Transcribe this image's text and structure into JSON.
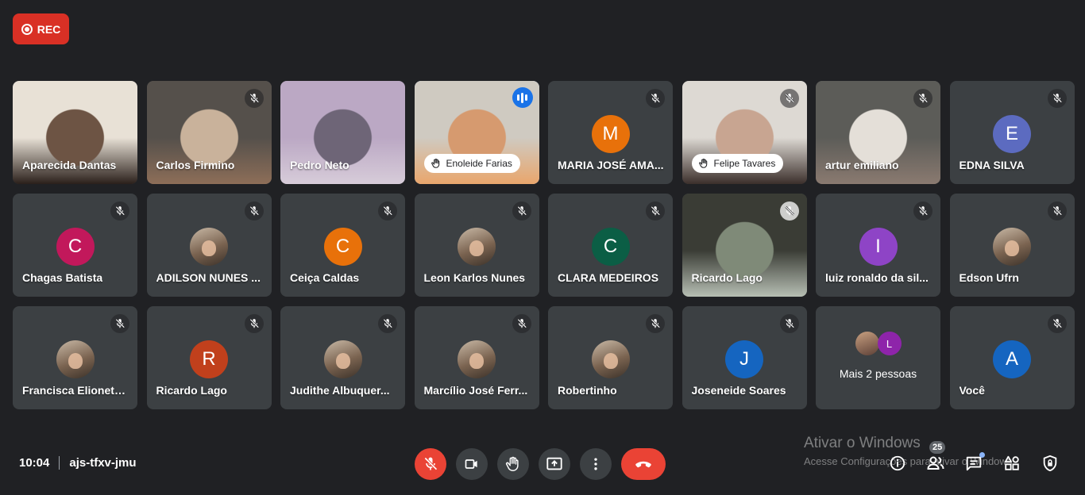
{
  "recording": {
    "label": "REC"
  },
  "tiles": [
    {
      "name": "Aparecida Dantas",
      "type": "video",
      "colors": [
        "#e8e1d6",
        "#6d5444",
        "#2a1f1a"
      ],
      "muted": false
    },
    {
      "name": "Carlos Firmino",
      "type": "video",
      "colors": [
        "#55504b",
        "#c9b29b",
        "#8d6e58"
      ],
      "muted": true
    },
    {
      "name": "Pedro Neto",
      "type": "video",
      "colors": [
        "#bba8c4",
        "#6e6577",
        "#d7ccd9"
      ],
      "muted": false
    },
    {
      "name": "Enoleide Farias",
      "type": "video-pill",
      "colors": [
        "#cfcac1",
        "#d69a6f",
        "#e9a66c"
      ],
      "speaking": true
    },
    {
      "name": "MARIA JOSÉ AMA...",
      "type": "initial",
      "initial": "M",
      "color": "#e8710a",
      "muted": true
    },
    {
      "name": "Felipe Tavares",
      "type": "video-pill",
      "colors": [
        "#ddd9d3",
        "#c8a591",
        "#3b2f2b"
      ],
      "muted": true
    },
    {
      "name": "artur emiliano",
      "type": "video",
      "colors": [
        "#5c5c58",
        "#e4dfd8",
        "#8a7a70"
      ],
      "muted": true
    },
    {
      "name": "EDNA SILVA",
      "type": "initial",
      "initial": "E",
      "color": "#5c6bc0",
      "muted": true
    },
    {
      "name": "Chagas Batista",
      "type": "initial",
      "initial": "C",
      "color": "#c2185b",
      "muted": true
    },
    {
      "name": "ADILSON NUNES ...",
      "type": "photo",
      "muted": true
    },
    {
      "name": "Ceiça Caldas",
      "type": "initial",
      "initial": "C",
      "color": "#e8710a",
      "muted": true
    },
    {
      "name": "Leon Karlos Nunes",
      "type": "photo",
      "muted": true
    },
    {
      "name": "CLARA MEDEIROS",
      "type": "initial",
      "initial": "C",
      "color": "#0b5e45",
      "muted": true
    },
    {
      "name": "Ricardo Lago",
      "type": "video",
      "colors": [
        "#3a3c35",
        "#7f8a78",
        "#b7bfb4"
      ],
      "muted": true,
      "light_mic": true
    },
    {
      "name": "luiz ronaldo da sil...",
      "type": "initial",
      "initial": "I",
      "color": "#8e44c6",
      "muted": true
    },
    {
      "name": "Edson Ufrn",
      "type": "photo",
      "muted": true
    },
    {
      "name": "Francisca Elionete...",
      "type": "photo",
      "muted": true
    },
    {
      "name": "Ricardo Lago",
      "type": "initial",
      "initial": "R",
      "color": "#c1401c",
      "muted": true
    },
    {
      "name": "Judithe Albuquer...",
      "type": "photo",
      "muted": true
    },
    {
      "name": "Marcílio José Ferr...",
      "type": "photo",
      "muted": true
    },
    {
      "name": "Robertinho",
      "type": "photo",
      "muted": true
    },
    {
      "name": "Joseneide Soares",
      "type": "initial",
      "initial": "J",
      "color": "#1565c0",
      "muted": true
    },
    {
      "name": "Mais 2 pessoas",
      "type": "more",
      "initial": "L"
    },
    {
      "name": "Você",
      "type": "initial",
      "initial": "A",
      "color": "#1565c0",
      "muted": true
    }
  ],
  "meeting": {
    "time": "10:04",
    "code": "ajs-tfxv-jmu"
  },
  "participants_count": "25",
  "watermark": {
    "title": "Ativar o Windows",
    "subtitle": "Acesse Configurações para ativar o Windows."
  }
}
